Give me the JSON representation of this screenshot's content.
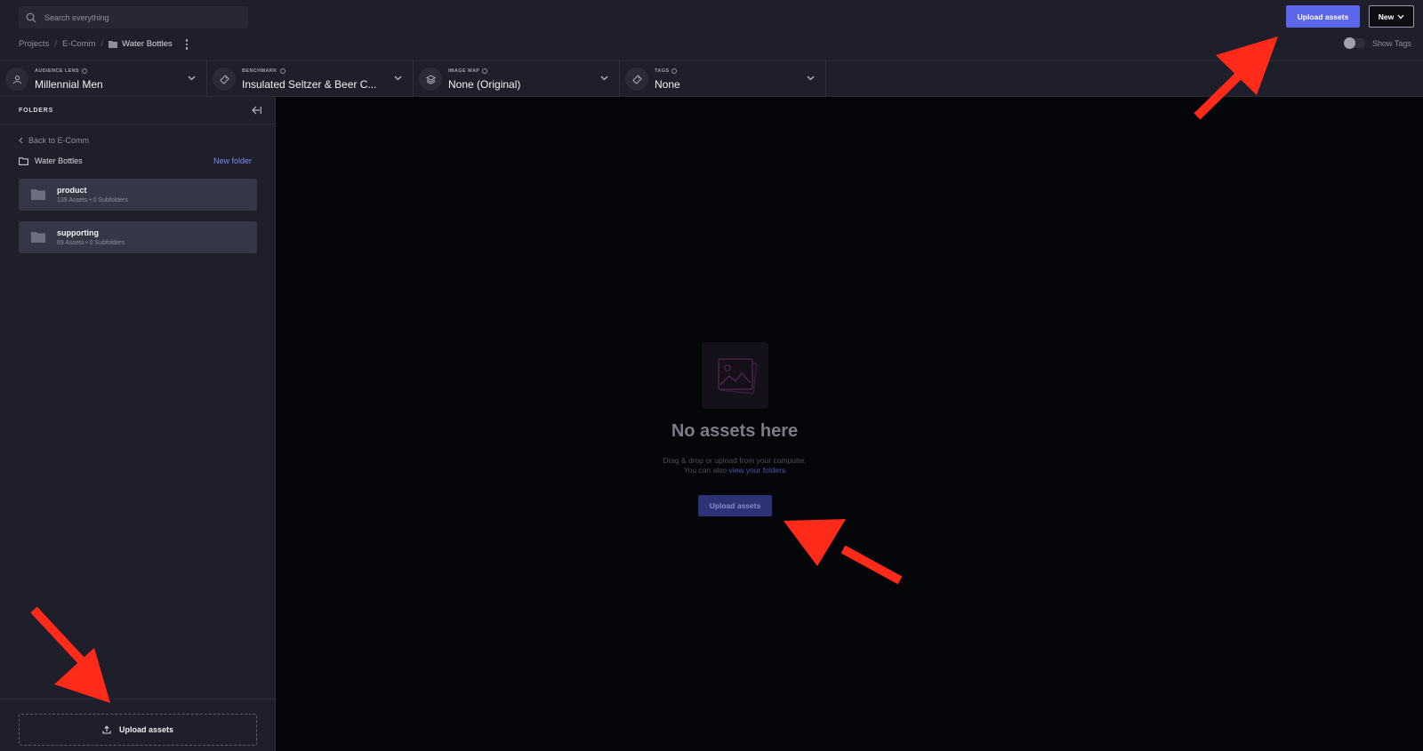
{
  "search": {
    "placeholder": "Search everything"
  },
  "breadcrumb": {
    "items": [
      "Projects",
      "E-Comm"
    ],
    "current": "Water Bottles"
  },
  "header": {
    "upload_label": "Upload assets",
    "new_label": "New",
    "show_tags_label": "Show Tags"
  },
  "filters": [
    {
      "label": "AUDIENCE LENS",
      "value": "Millennial Men",
      "icon": "person-icon"
    },
    {
      "label": "BENCHMARK",
      "value": "Insulated Seltzer & Beer C...",
      "icon": "tag-icon"
    },
    {
      "label": "IMAGE MAP",
      "value": "None (Original)",
      "icon": "layers-icon"
    },
    {
      "label": "TAGS",
      "value": "None",
      "icon": "tag-icon"
    }
  ],
  "sidebar": {
    "title": "FOLDERS",
    "back_label": "Back to E-Comm",
    "current_folder": "Water Bottles",
    "new_folder_label": "New folder",
    "folders": [
      {
        "name": "product",
        "meta": "139 Assets • 0 Subfolders"
      },
      {
        "name": "supporting",
        "meta": "69 Assets • 0 Subfolders"
      }
    ],
    "upload_label": "Upload assets"
  },
  "empty_state": {
    "title": "No assets here",
    "line1": "Drag & drop or upload from your computer.",
    "line2_prefix": "You can also ",
    "line2_link": "view your folders",
    "upload_label": "Upload assets"
  },
  "colors": {
    "accent": "#5b67e8",
    "annotation_arrow": "#ff2a1a",
    "panel": "#1e1f2a",
    "background": "#05060a"
  }
}
